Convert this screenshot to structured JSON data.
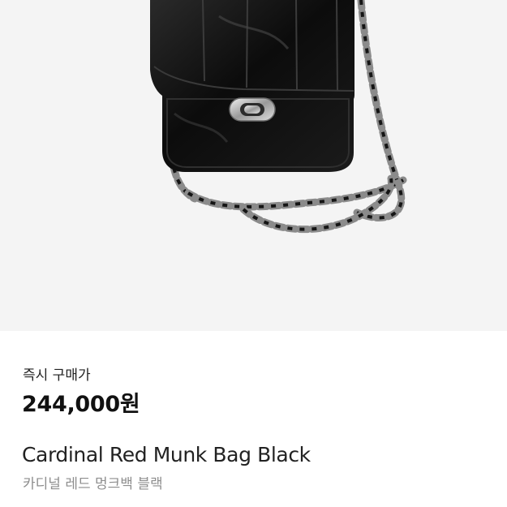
{
  "product": {
    "image_alt": "product-photo",
    "price_label": "즉시 구매가",
    "price": "244,000원",
    "name_en": "Cardinal Red Munk Bag Black",
    "name_ko": "카디널 레드 멍크백 블랙"
  }
}
